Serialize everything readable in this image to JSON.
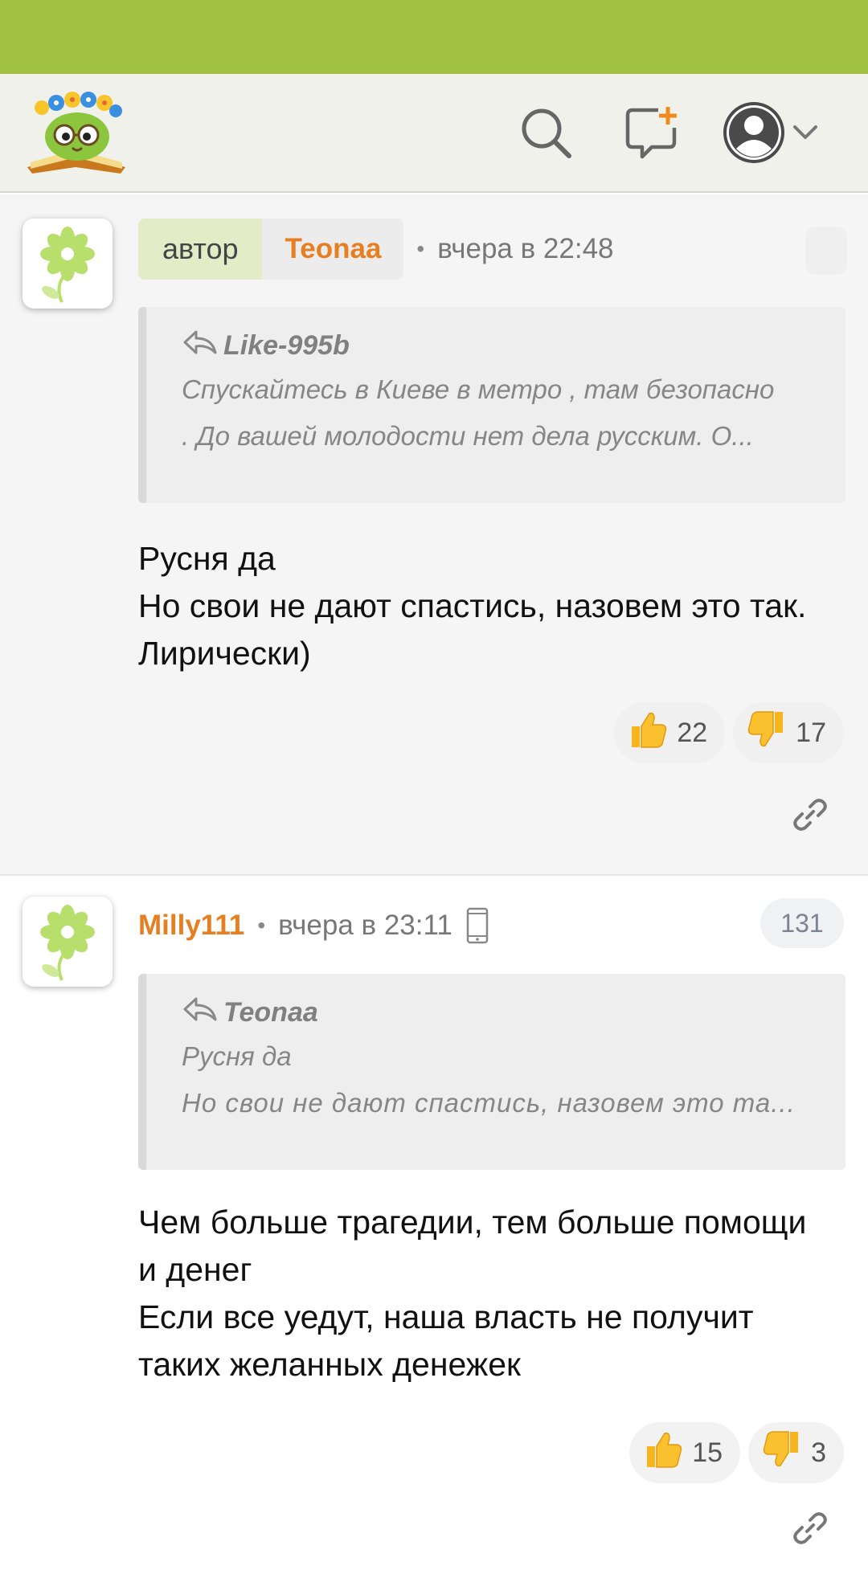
{
  "colors": {
    "status_bar": "#9fc043",
    "header_bg": "#f1f1ec",
    "author_orange": "#e67e22",
    "badge_green": "#e2edc7"
  },
  "header": {
    "icons": [
      "site-logo",
      "search-icon",
      "new-message-icon",
      "user-avatar-icon",
      "chevron-down-icon"
    ]
  },
  "comments": [
    {
      "badge_label": "автор",
      "author": "Teonaa",
      "separator": "•",
      "time": "вчера в 22:48",
      "quote": {
        "author": "Like-995b",
        "lines": [
          "Спускайтесь в Киеве в метро , там безопасно",
          ". До вашей молодости нет дела русским. О..."
        ]
      },
      "body": [
        "Русня да",
        "Но свои не дают спастись, назовем это так. Лирически)"
      ],
      "likes": "22",
      "dislikes": "17"
    },
    {
      "author": "Milly111",
      "separator": "•",
      "time": "вчера в 23:11",
      "counter": "131",
      "quote": {
        "author": "Teonaa",
        "lines": [
          "Русня да",
          "Но свои не дают спастись, назовем это та..."
        ]
      },
      "body": [
        "Чем больше трагедии, тем больше помощи и денег",
        "Если все уедут, наша власть не получит таких желанных денежек"
      ],
      "likes": "15",
      "dislikes": "3"
    }
  ]
}
